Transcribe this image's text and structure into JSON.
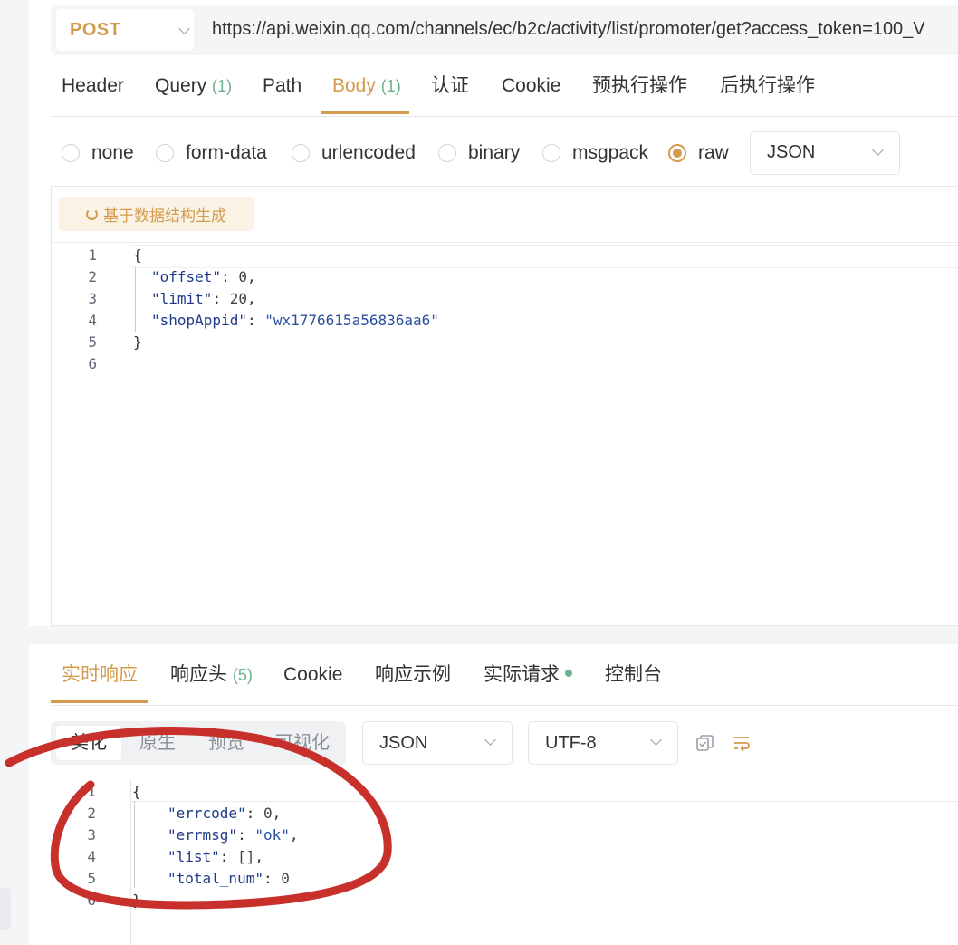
{
  "request": {
    "method": "POST",
    "url": "https://api.weixin.qq.com/channels/ec/b2c/activity/list/promoter/get?access_token=100_V",
    "tabs": [
      {
        "label": "Header",
        "count": ""
      },
      {
        "label": "Query",
        "count": "(1)"
      },
      {
        "label": "Path",
        "count": ""
      },
      {
        "label": "Body",
        "count": "(1)"
      },
      {
        "label": "认证",
        "count": ""
      },
      {
        "label": "Cookie",
        "count": ""
      },
      {
        "label": "预执行操作",
        "count": ""
      },
      {
        "label": "后执行操作",
        "count": ""
      }
    ],
    "active_tab": "Body",
    "body_types": [
      "none",
      "form-data",
      "urlencoded",
      "binary",
      "msgpack",
      "raw"
    ],
    "selected_body_type": "raw",
    "format": "JSON",
    "generate_button": "基于数据结构生成",
    "body_lines": [
      {
        "n": "1",
        "text": "{"
      },
      {
        "n": "2",
        "key": "\"offset\"",
        "sep": ": ",
        "val": "0",
        "tail": ","
      },
      {
        "n": "3",
        "key": "\"limit\"",
        "sep": ": ",
        "val": "20",
        "tail": ","
      },
      {
        "n": "4",
        "key": "\"shopAppid\"",
        "sep": ": ",
        "val": "\"wx1776615a56836aa6\"",
        "tail": ""
      },
      {
        "n": "5",
        "text": "}"
      },
      {
        "n": "6",
        "text": ""
      }
    ]
  },
  "response": {
    "tabs": [
      {
        "label": "实时响应",
        "count": ""
      },
      {
        "label": "响应头",
        "count": "(5)"
      },
      {
        "label": "Cookie",
        "count": ""
      },
      {
        "label": "响应示例",
        "count": ""
      },
      {
        "label": "实际请求",
        "count": ""
      },
      {
        "label": "控制台",
        "count": ""
      }
    ],
    "active_tab": "实时响应",
    "view_modes": [
      "美化",
      "原生",
      "预览",
      "可视化"
    ],
    "active_view": "美化",
    "format": "JSON",
    "encoding": "UTF-8",
    "body_lines": [
      {
        "n": "1",
        "text": "{"
      },
      {
        "n": "2",
        "key": "\"errcode\"",
        "sep": ": ",
        "val": "0",
        "tail": ","
      },
      {
        "n": "3",
        "key": "\"errmsg\"",
        "sep": ": ",
        "val": "\"ok\"",
        "tail": ","
      },
      {
        "n": "4",
        "key": "\"list\"",
        "sep": ": ",
        "val": "[]",
        "tail": ","
      },
      {
        "n": "5",
        "key": "\"total_num\"",
        "sep": ": ",
        "val": "0",
        "tail": ""
      },
      {
        "n": "6",
        "text": "}"
      }
    ]
  },
  "colors": {
    "accent": "#d39b4c",
    "count_green": "#6bb38c",
    "annotation_red": "#c8302c"
  },
  "icons": {
    "copy": "copy-icon",
    "wrap": "wrap-lines-icon",
    "refresh": "refresh-icon"
  }
}
